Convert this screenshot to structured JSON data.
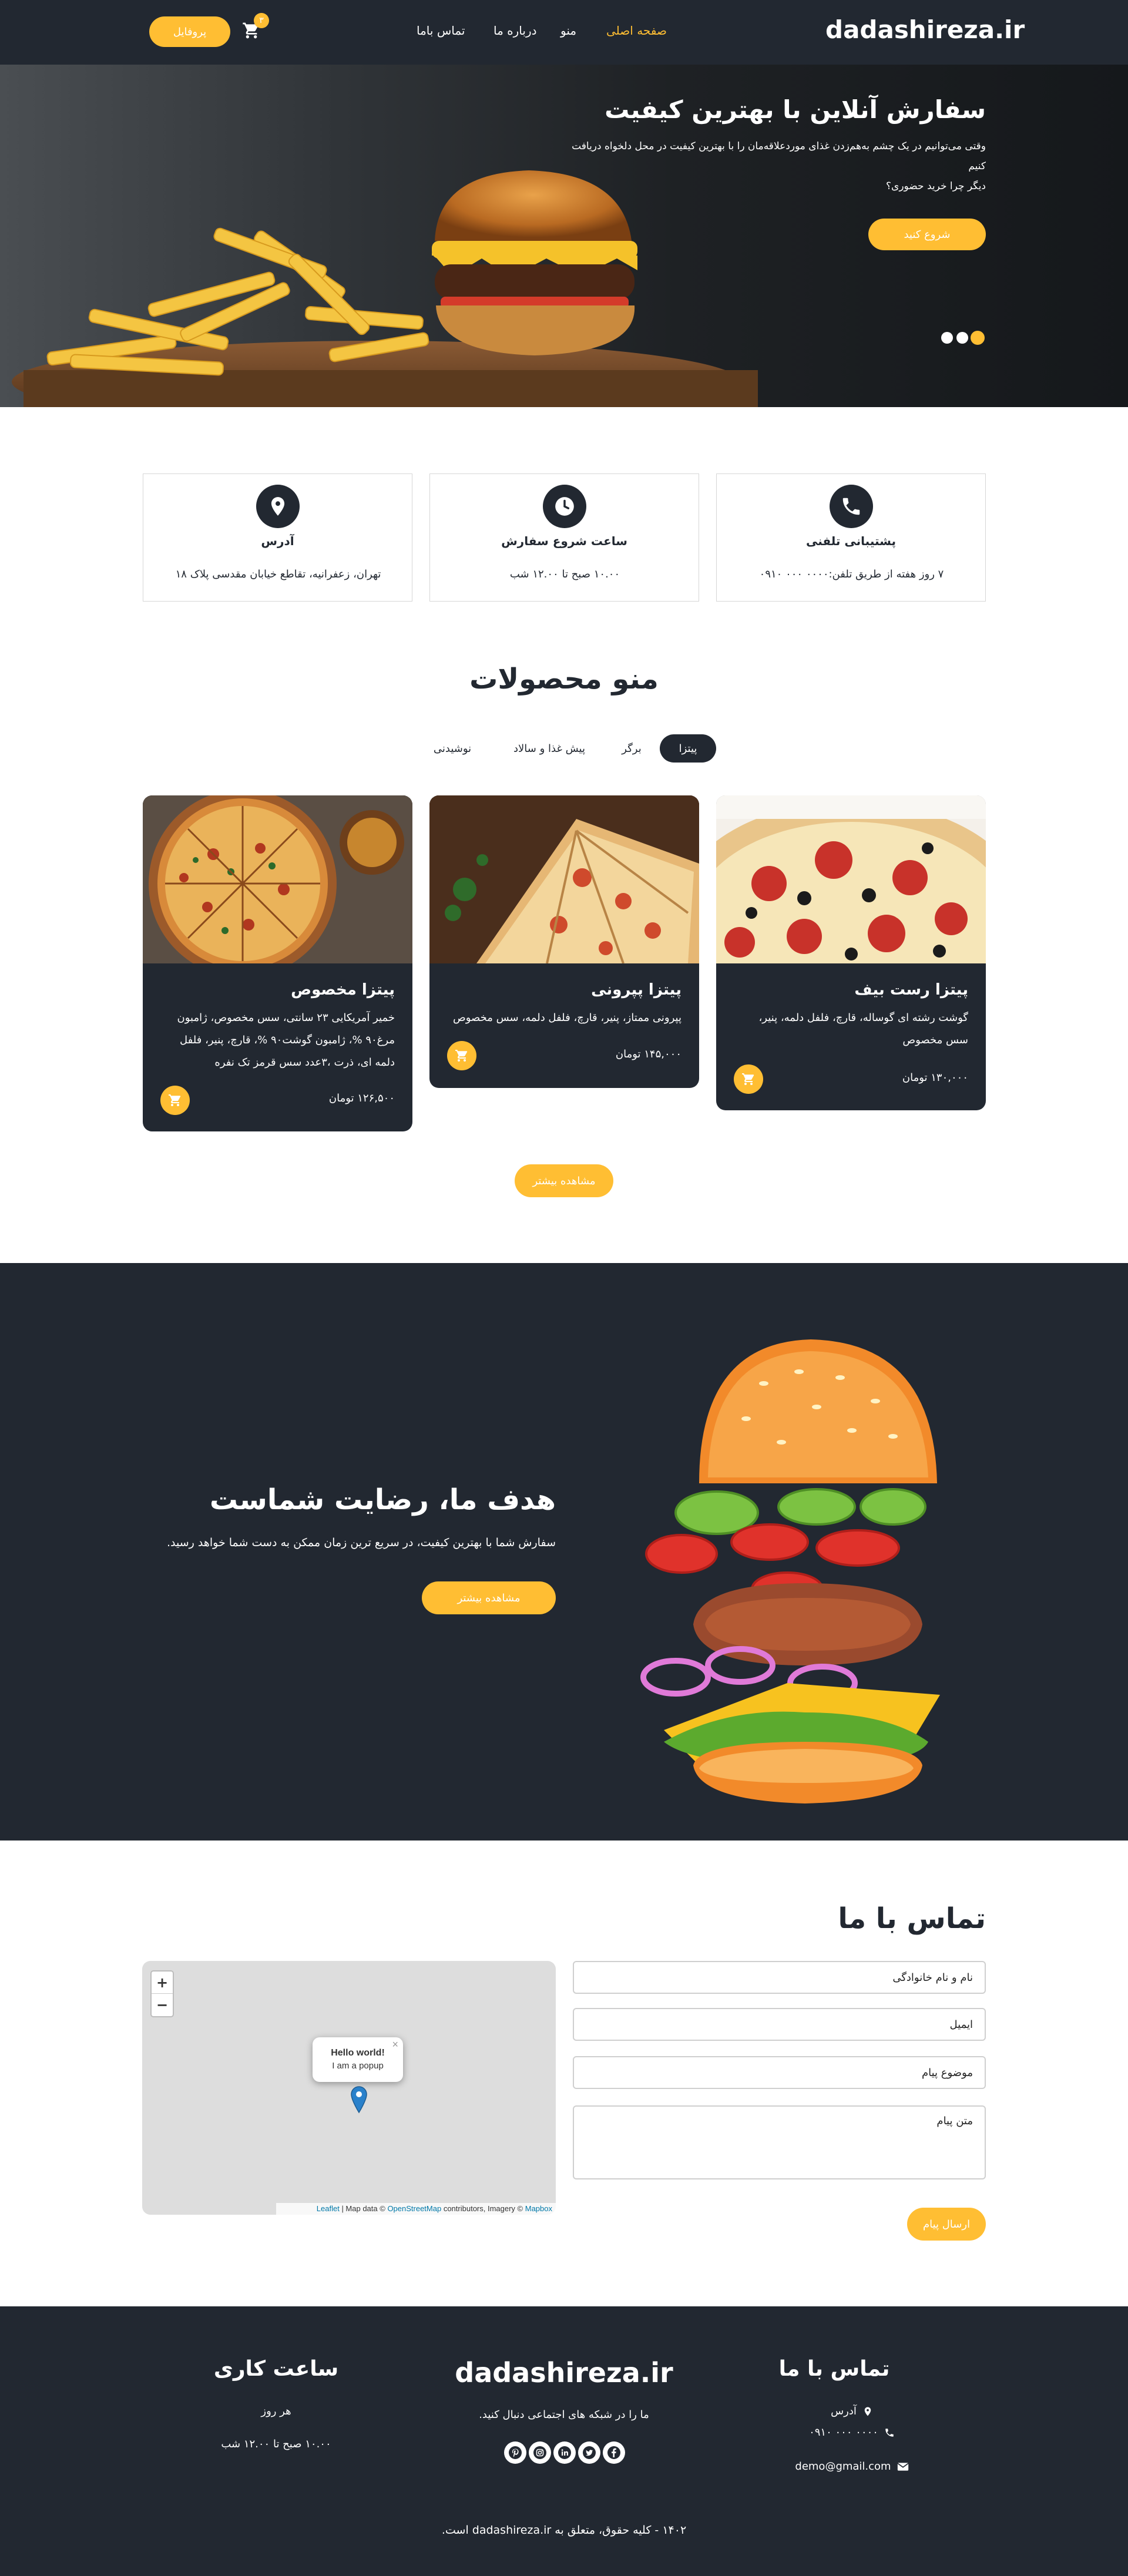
{
  "colors": {
    "dark": "#222831",
    "accent": "#ffbe33",
    "light": "#ffffff"
  },
  "header": {
    "brand": "dadashireza.ir",
    "nav": [
      {
        "label": "صفحه اصلی",
        "active": true
      },
      {
        "label": "منو",
        "active": false
      },
      {
        "label": "درباره ما",
        "active": false
      },
      {
        "label": "تماس باما",
        "active": false
      }
    ],
    "cart_icon": "cart-icon",
    "cart_count": "۳",
    "profile_label": "پروفایل"
  },
  "hero": {
    "title": "سفارش آنلاین با بهترین کیفیت",
    "line1": "وقتی می‌توانیم در یک چشم به‌هم‌زدن غذای موردعلاقه‌مان را با بهترین کیفیت در محل دلخواه دریافت",
    "line2": "کنیم",
    "line3": "دیگر چرا خرید حضوری؟",
    "button": "شروع کنید",
    "slides": 3,
    "active_slide": 1
  },
  "offers": [
    {
      "icon": "phone-icon",
      "title": "پشتیبانی تلفنی",
      "text": "۷ روز هفته از طریق تلفن:۰۰۰۰ ۰۰۰ ۰۹۱۰"
    },
    {
      "icon": "clock-icon",
      "title": "ساعت شروع سفارش",
      "text": "۱۰.۰۰ صبح تا ۱۲.۰۰ شب"
    },
    {
      "icon": "location-icon",
      "title": "آدرس",
      "text": "تهران، زعفرانیه، تقاطع خیابان مقدسی پلاک ۱۸"
    }
  ],
  "menu": {
    "title": "منو محصولات",
    "filters": [
      {
        "label": "پیتزا",
        "active": true
      },
      {
        "label": "برگر",
        "active": false
      },
      {
        "label": "پیش غذا و سالاد",
        "active": false
      },
      {
        "label": "نوشیدنی",
        "active": false
      }
    ],
    "products": [
      {
        "name": "پیتزا رست بیف",
        "desc1": "گوشت رشته ای گوساله، قارچ، فلفل دلمه، پنیر،",
        "desc2": "سس مخصوص",
        "desc3": "",
        "price": "۱۳۰,۰۰۰ تومان"
      },
      {
        "name": "پیتزا پپرونی",
        "desc1": "پپرونی ممتاز، پنیر، قارچ، فلفل دلمه، سس مخصوص",
        "desc2": "",
        "desc3": "",
        "price": "۱۴۵,۰۰۰ تومان"
      },
      {
        "name": "پیتزا مخصوص",
        "desc1": "خمیر آمریکایی ۲۳ سانتی، سس مخصوص، ژامبون",
        "desc2": "مرغ۹۰ %، ژامبون گوشت۹۰ %، قارچ، پنیر، فلفل",
        "desc3": "دلمه ای، ذرت ،۳عدد سس قرمز تک نفره",
        "price": "۱۲۶,۵۰۰ تومان"
      }
    ],
    "more_button": "مشاهده بیشتر"
  },
  "about": {
    "title": "هدف ما، رضایت شماست",
    "text": "سفارش شما با بهترین کیفیت، در سریع ترین زمان ممکن به دست شما خواهد رسید.",
    "button": "مشاهده بیشتر"
  },
  "contact": {
    "title": "تماس با ما",
    "name_placeholder": "نام و نام خانوادگی",
    "email_placeholder": "ایمیل",
    "subject_placeholder": "موضوع پیام",
    "message_placeholder": "متن پیام",
    "send_button": "ارسال پیام",
    "map": {
      "zoom_in": "+",
      "zoom_out": "−",
      "popup_title": "Hello world!",
      "popup_text": "I am a popup",
      "popup_close": "×",
      "attr_leaflet": "Leaflet",
      "attr_sep1": " | Map data © ",
      "attr_osm": "OpenStreetMap",
      "attr_sep2": " contributors, Imagery © ",
      "attr_mapbox": "Mapbox"
    }
  },
  "footer": {
    "contact_title": "تماس با ما",
    "address": "آدرس",
    "phone": "۰۰۰۰ ۰۰۰ ۰۹۱۰",
    "email": "demo@gmail.com",
    "brand": "dadashireza.ir",
    "follow_text": "ما را در شبکه های اجتماعی دنبال کنید.",
    "social": [
      "facebook-icon",
      "twitter-icon",
      "linkedin-icon",
      "instagram-icon",
      "pinterest-icon"
    ],
    "hours_title": "ساعت کاری",
    "hours_days": "هر روز",
    "hours_time": "۱۰.۰۰ صبح تا ۱۲.۰۰ شب",
    "copyright": "۱۴۰۲ - کلیه حقوق، متعلق به dadashireza.ir است."
  }
}
